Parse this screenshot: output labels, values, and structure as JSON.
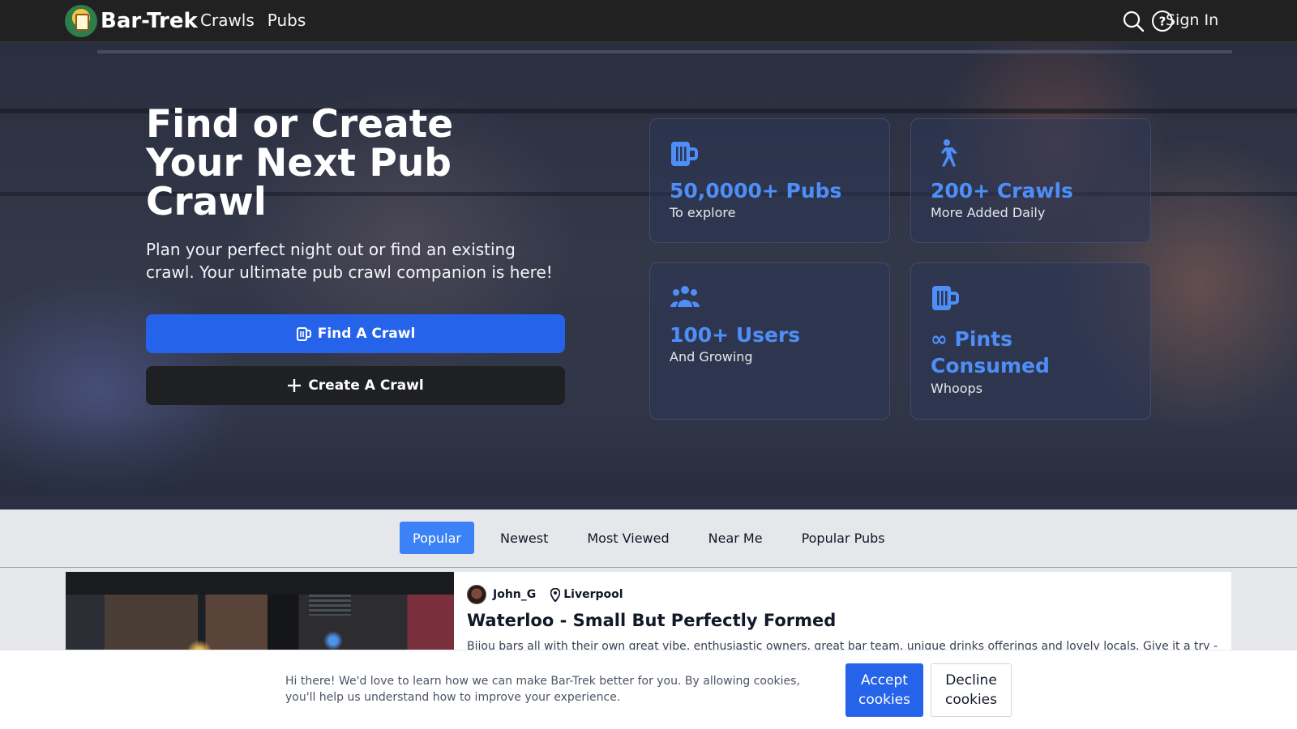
{
  "nav": {
    "brand": "Bar-Trek",
    "links": [
      "Crawls",
      "Pubs"
    ],
    "search_icon": "search-icon",
    "help_icon": "help-icon",
    "signin": "Sign In"
  },
  "hero": {
    "title": "Find or Create Your Next Pub Crawl",
    "subtitle": "Plan your perfect night out or find an existing crawl. Your ultimate pub crawl companion is here!",
    "find_button": "Find A Crawl",
    "create_button": "Create A Crawl",
    "stats": [
      {
        "icon": "beer-mug-icon",
        "value": "50,0000+ Pubs",
        "label": "To explore"
      },
      {
        "icon": "walking-person-icon",
        "value": "200+ Crawls",
        "label": "More Added Daily"
      },
      {
        "icon": "users-icon",
        "value": "100+ Users",
        "label": "And Growing"
      },
      {
        "icon": "beer-mug-icon",
        "value": "∞ Pints Consumed",
        "label": "Whoops"
      }
    ],
    "accent_color": "#4f8ef7"
  },
  "tabs": {
    "items": [
      "Popular",
      "Newest",
      "Most Viewed",
      "Near Me",
      "Popular Pubs"
    ],
    "active": "Popular"
  },
  "crawl": {
    "author": "John_G",
    "location": "Liverpool",
    "title": "Waterloo - Small But Perfectly Formed",
    "description": "Bijou bars all with their own great vibe, enthusiastic owners, great bar team, unique drinks offerings and lovely locals. Give it a try -"
  },
  "cookie": {
    "message": "Hi there! We'd love to learn how we can make Bar-Trek better for you. By allowing cookies, you'll help us understand how to improve your experience.",
    "accept": "Accept cookies",
    "decline": "Decline cookies"
  },
  "colors": {
    "primary": "#2563eb",
    "navbar": "#212121"
  }
}
